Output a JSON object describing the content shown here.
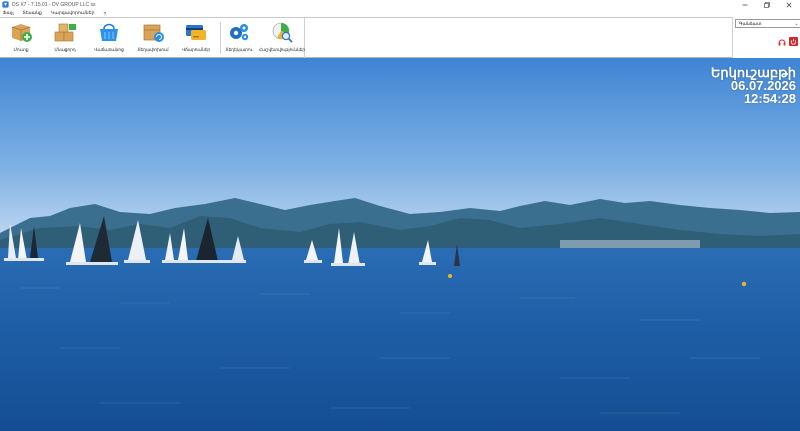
{
  "window": {
    "title": "DS X7 - 7.15.01 - DV GROUP LLC ss"
  },
  "menu": {
    "items": [
      "Ֆայլ",
      "Տեսանք",
      "Կարգավորումներ",
      "?"
    ]
  },
  "ribbon": {
    "buttons": [
      {
        "label": "Մուտք",
        "icon": "box-add-icon"
      },
      {
        "label": "Մնացորդ",
        "icon": "boxes-icon"
      },
      {
        "label": "Վաճառանոց",
        "icon": "basket-icon"
      },
      {
        "label": "Տեղափոխում",
        "icon": "box-refresh-icon"
      },
      {
        "label": "Վճարումներ",
        "icon": "cards-icon"
      },
      {
        "label": "Տեղեկատու",
        "icon": "gears-icon"
      },
      {
        "label": "Հաշվետվություններ",
        "icon": "report-search-icon"
      }
    ]
  },
  "right_panel": {
    "dropdown_value": "Գանձատ",
    "buttons": [
      "headset-icon",
      "power-icon"
    ]
  },
  "clock": {
    "day": "Երկուշաբթի",
    "date": "06.07.2026",
    "time": "12:54:28"
  },
  "colors": {
    "sky_top": "#3f86d6",
    "sky_bottom": "#cfe1f3",
    "sea": "#1d5ea6",
    "accent_red": "#d9272e"
  }
}
